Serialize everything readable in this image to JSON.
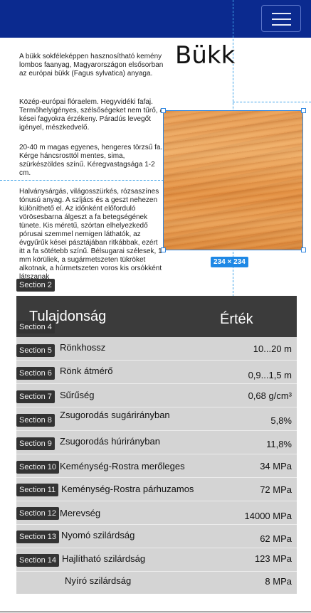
{
  "header": {
    "menu_icon": "hamburger-menu-icon",
    "bar_color": "#0b2a8f"
  },
  "article": {
    "title": "Bükk",
    "paragraphs": [
      "A bükk sokféleképpen hasznosítható kemény lombos faanyag, Magyarországon elsősorban az európai bükk (Fagus sylvatica) anyaga.",
      "Közép-európai flóraelem. Hegyvidéki fafaj. Termőhelyigényes, szélsőségeket nem tűrő, a kései fagyokra érzékeny. Páradús levegőt igényel, mészkedvelő.",
      "20-40 m magas egyenes, hengeres törzsű fa. Kérge háncsrosttól mentes, sima, szürkészöldes színű. Kéregvastagsága 1-2 cm.",
      "Halványsárgás, világosszürkés, rózsaszínes tónusú anyag. A szíjács és a geszt nehezen különíthető el. Az időnként előforduló vörösesbarna álgeszt a fa betegségének tünete. Kis méretű, szórtan elhelyezkedő pórusai szemmel nemigen láthatók, az évgyűrűk kései pásztájában ritkábbak, ezért itt a fa sötétebb színű. Bélsugarai szélesek, 1 mm körüliek, a sugármetszeten tükröket alkotnak, a húrmetszeten voros kis orsókként látszanak"
    ],
    "image_size_label": "234 × 234"
  },
  "sections": [
    "Section 2",
    "Section 4",
    "Section 5",
    "Section 6",
    "Section 7",
    "Section 8",
    "Section 9",
    "Section 10",
    "Section 11",
    "Section 12",
    "Section 13",
    "Section 14"
  ],
  "table": {
    "headers": {
      "property": "Tulajdonság",
      "value": "Érték"
    },
    "rows": [
      {
        "name": "Rönkhossz",
        "value": "10...20 m"
      },
      {
        "name": "Rönk átmérő",
        "value": "0,9...1,5 m"
      },
      {
        "name": "Sűrűség",
        "value": "0,68 g/cm³"
      },
      {
        "name": "Zsugorodás sugárirányban",
        "value": "5,8%"
      },
      {
        "name": "Zsugorodás húrirányban",
        "value": "11,8%"
      },
      {
        "name": "Keménység-Rostra merőleges",
        "value": "34 MPa"
      },
      {
        "name": "Keménység-Rostra párhuzamos",
        "value": "72 MPa"
      },
      {
        "name": "Merevség",
        "value": "14000 MPa"
      },
      {
        "name": "Nyomó szilárdság",
        "value": "62 MPa"
      },
      {
        "name": "Hajlítható szilárdság",
        "value": "123 MPa"
      },
      {
        "name": "Nyíró szilárdság",
        "value": "8 MPa"
      }
    ]
  }
}
